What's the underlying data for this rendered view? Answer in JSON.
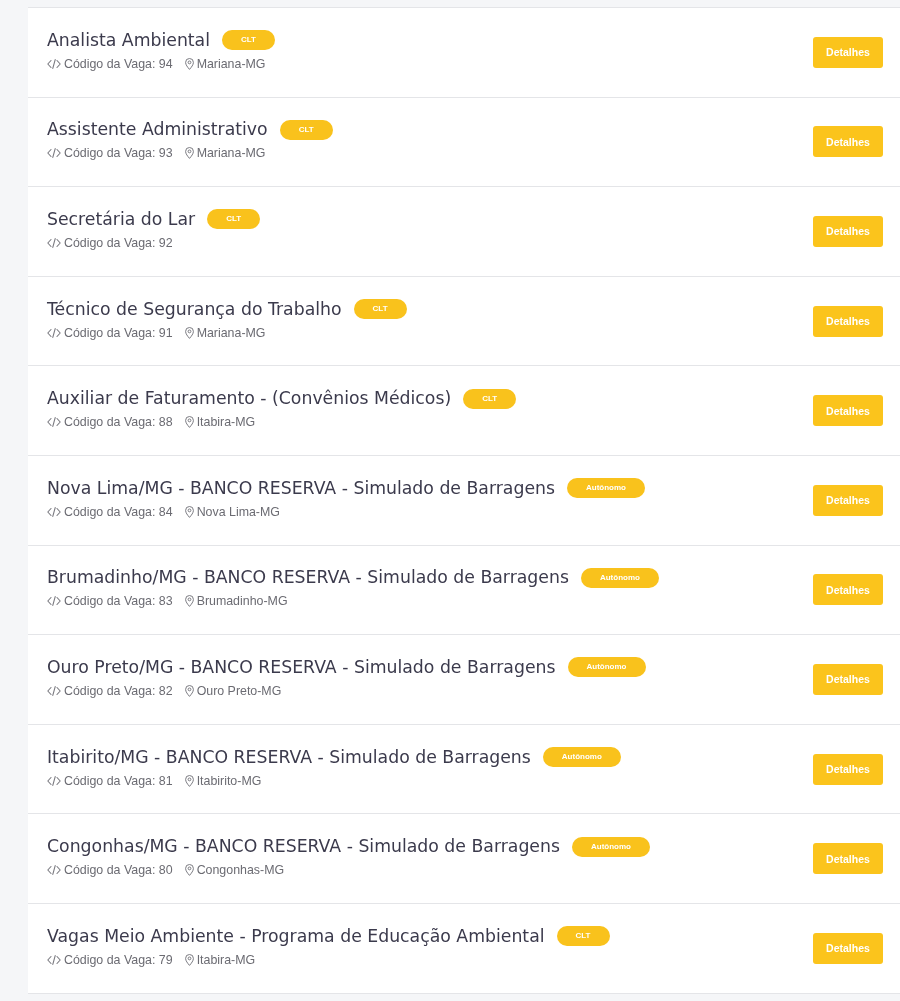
{
  "jobs": [
    {
      "title": "Analista Ambiental",
      "badge": "CLT",
      "code": "Código da Vaga: 94",
      "location": "Mariana-MG",
      "button": "Detalhes"
    },
    {
      "title": "Assistente Administrativo",
      "badge": "CLT",
      "code": "Código da Vaga: 93",
      "location": "Mariana-MG",
      "button": "Detalhes"
    },
    {
      "title": "Secretária do Lar",
      "badge": "CLT",
      "code": "Código da Vaga: 92",
      "button": "Detalhes"
    },
    {
      "title": "Técnico de Segurança do Trabalho",
      "badge": "CLT",
      "code": "Código da Vaga: 91",
      "location": "Mariana-MG",
      "button": "Detalhes"
    },
    {
      "title": "Auxiliar de Faturamento - (Convênios Médicos)",
      "badge": "CLT",
      "code": "Código da Vaga: 88",
      "location": "Itabira-MG",
      "button": "Detalhes"
    },
    {
      "title": "Nova Lima/MG - BANCO RESERVA - Simulado de Barragens",
      "badge": "Autônomo",
      "code": "Código da Vaga: 84",
      "location": "Nova Lima-MG",
      "button": "Detalhes"
    },
    {
      "title": "Brumadinho/MG - BANCO RESERVA - Simulado de Barragens",
      "badge": "Autônomo",
      "code": "Código da Vaga: 83",
      "location": "Brumadinho-MG",
      "button": "Detalhes"
    },
    {
      "title": "Ouro Preto/MG - BANCO RESERVA - Simulado de Barragens",
      "badge": "Autônomo",
      "code": "Código da Vaga: 82",
      "location": "Ouro Preto-MG",
      "button": "Detalhes"
    },
    {
      "title": "Itabirito/MG - BANCO RESERVA - Simulado de Barragens",
      "badge": "Autônomo",
      "code": "Código da Vaga: 81",
      "location": "Itabirito-MG",
      "button": "Detalhes"
    },
    {
      "title": "Congonhas/MG - BANCO RESERVA - Simulado de Barragens",
      "badge": "Autônomo",
      "code": "Código da Vaga: 80",
      "location": "Congonhas-MG",
      "button": "Detalhes"
    },
    {
      "title": "Vagas Meio Ambiente - Programa de Educação Ambiental",
      "badge": "CLT",
      "code": "Código da Vaga: 79",
      "location": "Itabira-MG",
      "button": "Detalhes"
    }
  ]
}
